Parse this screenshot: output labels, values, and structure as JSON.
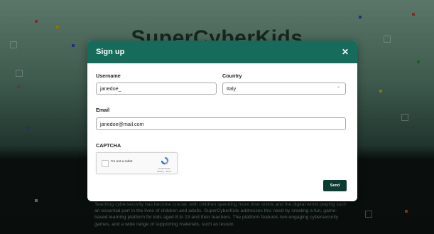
{
  "hero": {
    "title": "SuperCyberKids",
    "body": "Teaching cybersecurity has become crucial, with children spending more time online and the digital world playing such an essential part in the lives of children and adults. SuperCyberKids addresses this need by creating a fun, game-based learning platform for kids aged 8 to 13 and their teachers. The platform features two engaging cybersecurity games, and a wide range of supporting materials, such as lesson"
  },
  "modal": {
    "title": "Sign up",
    "close_icon": "close-icon",
    "username": {
      "label": "Username",
      "value": "janedoe_"
    },
    "country": {
      "label": "Country",
      "value": "Italy",
      "icon": "chevron-icon"
    },
    "email": {
      "label": "Email",
      "value": "janedoe@mail.com"
    },
    "captcha": {
      "label": "CAPTCHA",
      "checkbox_label": "I'm not a robot",
      "brand_small": "reCAPTCHA",
      "links_small": "Privacy - Terms"
    },
    "send_label": "Send"
  },
  "colors": {
    "header": "#176b5b",
    "send_button": "#0e3b31"
  }
}
